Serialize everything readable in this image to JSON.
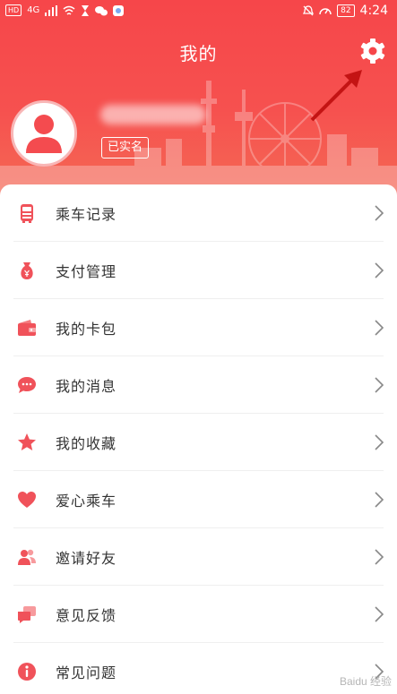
{
  "status_bar": {
    "badge": "HD",
    "network": "4G",
    "battery": "82",
    "time": "4:24"
  },
  "header": {
    "title": "我的"
  },
  "profile": {
    "verified_badge": "已实名"
  },
  "menu": [
    {
      "label": "乘车记录",
      "icon": "bus-record-icon"
    },
    {
      "label": "支付管理",
      "icon": "money-bag-icon"
    },
    {
      "label": "我的卡包",
      "icon": "wallet-icon"
    },
    {
      "label": "我的消息",
      "icon": "message-icon"
    },
    {
      "label": "我的收藏",
      "icon": "star-icon"
    },
    {
      "label": "爱心乘车",
      "icon": "heart-icon"
    },
    {
      "label": "邀请好友",
      "icon": "friends-icon"
    },
    {
      "label": "意见反馈",
      "icon": "feedback-icon"
    },
    {
      "label": "常见问题",
      "icon": "info-icon"
    }
  ],
  "watermark": "Baidu 经验",
  "colors": {
    "brand_red": "#f6464a",
    "icon_red": "#f0525a"
  }
}
